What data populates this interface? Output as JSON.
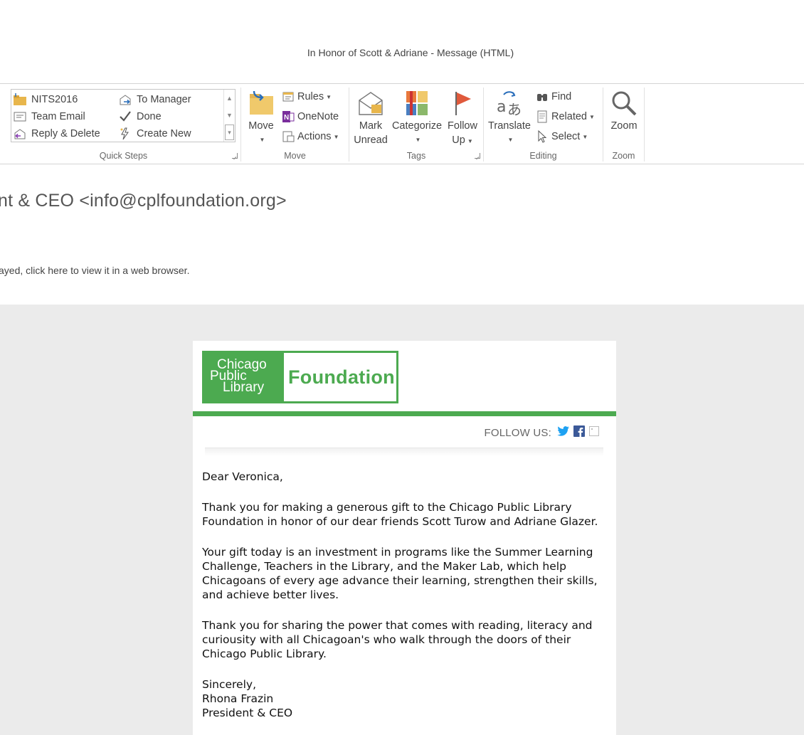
{
  "window": {
    "title": "In Honor of Scott & Adriane - Message (HTML)"
  },
  "ribbon": {
    "quick_steps": {
      "label": "Quick Steps",
      "items": [
        "NITS2016",
        "Team Email",
        "Reply & Delete",
        "To Manager",
        "Done",
        "Create New"
      ]
    },
    "move": {
      "label": "Move",
      "move_btn": "Move",
      "rules": "Rules",
      "onenote": "OneNote",
      "actions": "Actions"
    },
    "tags": {
      "label": "Tags",
      "mark_unread_1": "Mark",
      "mark_unread_2": "Unread",
      "categorize": "Categorize",
      "follow_up_1": "Follow",
      "follow_up_2": "Up"
    },
    "editing": {
      "label": "Editing",
      "translate": "Translate",
      "find": "Find",
      "related": "Related",
      "select": "Select"
    },
    "zoom": {
      "label": "Zoom",
      "zoom_btn": "Zoom"
    }
  },
  "message": {
    "sender": "nt & CEO <info@cplfoundation.org>",
    "infobar": "ayed, click here to view it in a web browser."
  },
  "email": {
    "logo": {
      "line1": "Chicago",
      "line2": "Public",
      "line3": "Library",
      "foundation": "Foundation"
    },
    "follow_label": "FOLLOW US:",
    "colors": {
      "brand_green": "#4caa50",
      "twitter": "#1da1f2",
      "facebook": "#3b5998"
    },
    "greeting": "Dear Veronica,",
    "para1": "Thank you for making a generous gift to the Chicago Public Library Foundation in honor of our dear friends Scott Turow and Adriane Glazer.",
    "para2": "Your gift today is an investment in programs like the Summer Learning Challenge, Teachers in the Library, and the Maker Lab, which help Chicagoans of every age advance their learning, strengthen their skills, and achieve better lives.",
    "para3": "Thank you for sharing the power that comes with reading, literacy and curiousity with all Chicagoan's who walk through the doors of their Chicago Public Library.",
    "closing": "Sincerely,",
    "sig_name": "Rhona Frazin",
    "sig_title": "President & CEO"
  }
}
